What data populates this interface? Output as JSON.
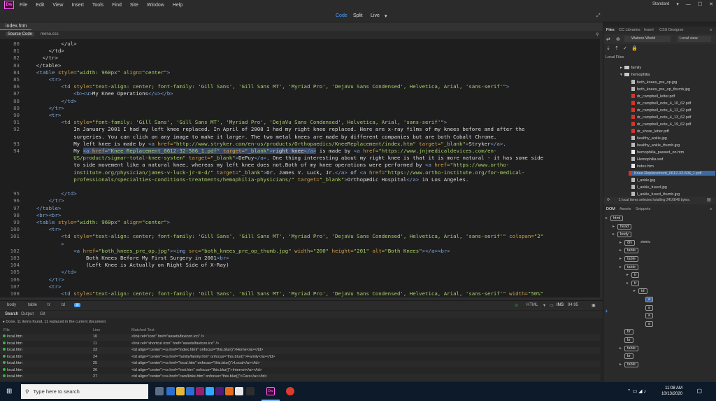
{
  "app": {
    "logo": "Dw",
    "menus": [
      "File",
      "Edit",
      "View",
      "Insert",
      "Tools",
      "Find",
      "Site",
      "Window",
      "Help"
    ],
    "workspace": "Standard"
  },
  "views": {
    "code": "Code",
    "split": "Split",
    "live": "Live"
  },
  "doc": {
    "tab": "index.htm",
    "related": [
      "Source Code",
      "menu.css"
    ]
  },
  "code": [
    {
      "n": "80",
      "h": "            &lt;/ul&gt;"
    },
    {
      "n": "81",
      "h": "        &lt;/td&gt;"
    },
    {
      "n": "82",
      "h": "      &lt;/tr&gt;"
    },
    {
      "n": "83",
      "h": "    &lt;/table&gt;"
    },
    {
      "n": "84",
      "h": "    <span class=t>&lt;table</span> <span class=at>style=</span><span class=v>\"width: 960px\"</span> <span class=at>align=</span><span class=v>\"center\"</span><span class=t>&gt;</span>"
    },
    {
      "n": "85",
      "h": "        <span class=t>&lt;tr&gt;</span>"
    },
    {
      "n": "86",
      "h": "            <span class=t>&lt;td</span> <span class=at>style=</span><span class=v>\"text-align: center; font-family: 'Gill Sans', 'Gill Sans MT', 'Myriad Pro', 'DejaVu Sans Condensed', Helvetica, Arial, 'sans-serif'\"</span><span class=t>&gt;</span>"
    },
    {
      "n": "87",
      "h": "                <span class=t>&lt;b&gt;&lt;u&gt;</span><span class=tx>My Knee Operations</span><span class=t>&lt;/u&gt;&lt;/b&gt;</span>"
    },
    {
      "n": "88",
      "h": "            <span class=t>&lt;/td&gt;</span>"
    },
    {
      "n": "89",
      "h": "        <span class=t>&lt;/tr&gt;</span>"
    },
    {
      "n": "90",
      "h": "        <span class=t>&lt;tr&gt;</span>"
    },
    {
      "n": "91",
      "h": "            <span class=t>&lt;td</span> <span class=at>style=</span><span class=v>\"font-family: 'Gill Sans', 'Gill Sans MT', 'Myriad Pro', 'DejaVu Sans Condensed', Helvetica, Arial, 'sans-serif'\"</span><span class=t>&gt;</span>"
    },
    {
      "n": "92",
      "h": "                <span class=tx>In January 2001 I had my left knee replaced. In April of 2008 I had my right knee replaced. Here are x-ray films of my knees before and after the</span>"
    },
    {
      "n": "",
      "h": "                <span class=tx>surgeries. You can click on any image to make it larger. The two metal knees are made by different companies but are both Cobalt Chrome.</span>"
    },
    {
      "n": "93",
      "h": "                <span class=tx>My left knee is made by </span><span class=t>&lt;a</span> <span class=at>href=</span><span class=v>\"http://www.stryker.com/en-us/products/Orthopaedics/KneeReplacement/index.htm\"</span> <span class=at>target=</span><span class=v>\"_blank\"</span><span class=t>&gt;</span><span class=tx>Stryker</span><span class=t>&lt;/a&gt;</span>."
    },
    {
      "n": "94",
      "h": "                <span class=tx>My </span><span class=sel><span class=t>&lt;a</span> <span class=at>href=</span><span class=v>\"Knee Replacement_0612-32-506_1.pdf\"</span> <span class=at>target=</span><span class=v>\"_blank\"</span><span class=t>&gt;</span><span class=tx>right knee</span><span class=t>&lt;/a&gt;</span></span><span class=tx> is made by </span><span class=t>&lt;a</span> <span class=at>href=</span><span class=v>\"https://www.jnjmedicaldevices.com/en-</span>"
    },
    {
      "n": "",
      "h": "                <span class=v>US/product/sigmar-total-knee-system\"</span> <span class=at>target=</span><span class=v>\"_blank\"</span><span class=t>&gt;</span><span class=tx>DePuy</span><span class=t>&lt;/a&gt;</span><span class=tx>. One thing interesting about my right knee is that it is more natural - it has some side</span>"
    },
    {
      "n": "",
      "h": "                <span class=tx>to side movement like a natural knee, whereas my left knee does not.Both of my knee operations were performed by </span><span class=t>&lt;a</span> <span class=at>href=</span><span class=v>\"https://www.ortho-</span>"
    },
    {
      "n": "",
      "h": "                <span class=v>institute.org/physician/james-v-luck-jr-m-d/\"</span> <span class=at>target=</span><span class=v>\"_blank\"</span><span class=t>&gt;</span><span class=tx>Dr. James V. Luck, Jr.</span><span class=t>&lt;/a&gt;</span><span class=tx> of </span><span class=t>&lt;a</span> <span class=at>href=</span><span class=v>\"https://www.ortho-institute.org/for-medical-</span>"
    },
    {
      "n": "",
      "h": "                <span class=v>professionals/specialties-conditions-treatments/hemophilia-physicians/\"</span> <span class=at>target=</span><span class=v>\"_blank\"</span><span class=t>&gt;</span><span class=tx>Orthopædic Hospital</span><span class=t>&lt;/a&gt;</span><span class=tx> in Los Angeles.</span>"
    },
    {
      "n": "",
      "h": ""
    },
    {
      "n": "95",
      "h": "            <span class=t>&lt;/td&gt;</span>"
    },
    {
      "n": "96",
      "h": "        <span class=t>&lt;/tr&gt;</span>"
    },
    {
      "n": "97",
      "h": "    <span class=t>&lt;/table&gt;</span>"
    },
    {
      "n": "98",
      "h": "    <span class=t>&lt;br&gt;&lt;br&gt;</span>"
    },
    {
      "n": "99",
      "h": "    <span class=t>&lt;table</span> <span class=at>style=</span><span class=v>\"width: 960px\"</span> <span class=at>align=</span><span class=v>\"center\"</span><span class=t>&gt;</span>"
    },
    {
      "n": "100",
      "h": "        <span class=t>&lt;tr&gt;</span>"
    },
    {
      "n": "101",
      "h": "            <span class=t>&lt;td</span> <span class=at>style=</span><span class=v>\"text-align: center; font-family: 'Gill Sans', 'Gill Sans MT', 'Myriad Pro', 'DejaVu Sans Condensed', Helvetica, Arial, 'sans-serif'\"</span> <span class=at>colspan=</span><span class=v>\"2\"</span>"
    },
    {
      "n": "",
      "h": "            <span class=t>&gt;</span>"
    },
    {
      "n": "102",
      "h": "                <span class=t>&lt;a</span> <span class=at>href=</span><span class=v>\"both_knees_pre_op.jpg\"</span><span class=t>&gt;&lt;img</span> <span class=at>src=</span><span class=v>\"both_knees_pre_op_thumb.jpg\"</span> <span class=at>width=</span><span class=v>\"200\"</span> <span class=at>height=</span><span class=v>\"201\"</span> <span class=at>alt=</span><span class=v>\"Both Knees\"</span><span class=t>&gt;&lt;/a&gt;&lt;br&gt;</span>"
    },
    {
      "n": "103",
      "h": "                    <span class=tx>Both Knees Before My First Surgery in 2001</span><span class=t>&lt;br&gt;</span>"
    },
    {
      "n": "104",
      "h": "                    <span class=tx>(Left Knee is Actually on Right Side of X-Ray)</span>"
    },
    {
      "n": "105",
      "h": "            <span class=t>&lt;/td&gt;</span>"
    },
    {
      "n": "106",
      "h": "        <span class=t>&lt;/tr&gt;</span>"
    },
    {
      "n": "107",
      "h": "        <span class=t>&lt;tr&gt;</span>"
    },
    {
      "n": "108",
      "h": "            <span class=t>&lt;td</span> <span class=at>style=</span><span class=v>\"text-align: center; font-family: 'Gill Sans', 'Gill Sans MT', 'Myriad Pro', 'DejaVu Sans Condensed', Helvetica, Arial, 'sans-serif'\"</span> <span class=at>width=</span><span class=v>\"50%\"</span>"
    }
  ],
  "status": {
    "crumbs": [
      "body",
      "table",
      "tr",
      "td",
      "a"
    ],
    "mode": "HTML",
    "ins": "INS",
    "pos": "94:95"
  },
  "search": {
    "tabs": [
      "Search",
      "Output",
      "Git"
    ],
    "message": "Done. 11 items found, 11 replaced in the current document.",
    "cols": [
      "File",
      "Line",
      "Matched Text"
    ],
    "rows": [
      {
        "file": "local.htm",
        "line": "10",
        "text": "<link rel=\"icon\" href=\"assets/favicon.ico\" />"
      },
      {
        "file": "local.htm",
        "line": "11",
        "text": "<link rel=\"shortcut icon\" href=\"assets/favicon.ico\" />"
      },
      {
        "file": "local.htm",
        "line": "23",
        "text": "<td align=\"center\"><a href=\"index.html\" onfocus=\"this.blur()\">Home</a></td>"
      },
      {
        "file": "local.htm",
        "line": "24",
        "text": "<td align=\"center\"><a href=\"family/family.htm\" onfocus=\"this.blur()\">Family</a></td>"
      },
      {
        "file": "local.htm",
        "line": "25",
        "text": "<td align=\"center\"><a href=\"local.htm\" onfocus=\"this.blur()\">Local</a></td>"
      },
      {
        "file": "local.htm",
        "line": "26",
        "text": "<td align=\"center\"><a href=\"inet.htm\" onfocus=\"this.blur()\">Internet</a></td>"
      },
      {
        "file": "local.htm",
        "line": "27",
        "text": "<td align=\"center\"><a href=\"cars/links.htm\" onfocus=\"this.blur()\">Cars</a></td>"
      }
    ]
  },
  "files": {
    "tabs": [
      "Files",
      "CC Libraries",
      "Insert",
      "CSS Designer"
    ],
    "site": "Watson World",
    "view": "Local view",
    "header": "Local Files",
    "items": [
      {
        "name": "family",
        "type": "fold"
      },
      {
        "name": "hemophilia",
        "type": "fold"
      },
      {
        "name": "both_knees_pre_op.jpg",
        "type": "img"
      },
      {
        "name": "both_knees_pre_op_thumb.jpg",
        "type": "img"
      },
      {
        "name": "dr_campbell_letter.pdf",
        "type": "pdf"
      },
      {
        "name": "dr_campbell_note_4_10_62.pdf",
        "type": "pdf"
      },
      {
        "name": "dr_campbell_note_4_12_62.pdf",
        "type": "pdf"
      },
      {
        "name": "dr_campbell_note_4_13_62.pdf",
        "type": "pdf"
      },
      {
        "name": "dr_campbell_note_4_19_62.pdf",
        "type": "pdf"
      },
      {
        "name": "dr_shore_letter.pdf",
        "type": "pdf"
      },
      {
        "name": "healthy_ankle.jpg",
        "type": "img"
      },
      {
        "name": "healthy_ankle_thumb.jpg",
        "type": "img"
      },
      {
        "name": "hemophilia_passed_on.htm",
        "type": "html"
      },
      {
        "name": "Hemophilia.swf",
        "type": "img"
      },
      {
        "name": "index.htm",
        "type": "html"
      },
      {
        "name": "Knee Replacement_0612-32-506_1.pdf",
        "type": "pdf"
      },
      {
        "name": "l_ankle.jpg",
        "type": "img"
      },
      {
        "name": "l_ankle_fused.jpg",
        "type": "img"
      },
      {
        "name": "l_ankle_fused_thumb.jpg",
        "type": "img"
      }
    ],
    "status": "1 local items selected totalling 2416846 bytes."
  },
  "dom": {
    "tabs": [
      "DOM",
      "Assets",
      "Snippets"
    ],
    "nodes": [
      {
        "label": "html",
        "d": 0
      },
      {
        "label": "head",
        "d": 1
      },
      {
        "label": "body",
        "d": 1
      },
      {
        "label": "div",
        "d": 2,
        "extra": ".menu"
      },
      {
        "label": "table",
        "d": 2
      },
      {
        "label": "table",
        "d": 2
      },
      {
        "label": "table",
        "d": 2
      },
      {
        "label": "tr",
        "d": 3
      },
      {
        "label": "tr",
        "d": 3
      },
      {
        "label": "td",
        "d": 4
      },
      {
        "label": "a",
        "d": 5
      },
      {
        "label": "a",
        "d": 5
      },
      {
        "label": "a",
        "d": 5
      },
      {
        "label": "a",
        "d": 5
      },
      {
        "label": "br",
        "d": 2
      },
      {
        "label": "br",
        "d": 2
      },
      {
        "label": "table",
        "d": 2
      },
      {
        "label": "br",
        "d": 2
      },
      {
        "label": "table",
        "d": 2
      }
    ]
  },
  "taskbar": {
    "search_placeholder": "Type here to search",
    "time": "11:08 AM",
    "date": "10/13/2020"
  }
}
